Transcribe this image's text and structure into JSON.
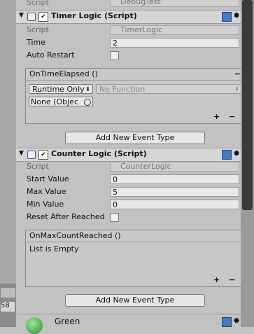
{
  "top": {
    "script_label": "Script",
    "script_value": "DebugTest"
  },
  "timer": {
    "title": "Timer Logic (Script)",
    "script_label": "Script",
    "script_value": "TimerLogic",
    "time_label": "Time",
    "time_value": "2",
    "auto_restart_label": "Auto Restart",
    "event_title": "OnTimeElapsed ()",
    "runtime_option": "Runtime Only",
    "function_option": "No Function",
    "none_object": "None (Objec",
    "add_event_label": "Add New Event Type"
  },
  "counter": {
    "title": "Counter Logic (Script)",
    "script_label": "Script",
    "script_value": "CounterLogic",
    "start_label": "Start Value",
    "start_value": "0",
    "max_label": "Max Value",
    "max_value": "5",
    "min_label": "Min Value",
    "min_value": "0",
    "reset_label": "Reset After Reached",
    "event_title": "OnMaxCountReached ()",
    "empty_text": "List is Empty",
    "add_event_label": "Add New Event Type"
  },
  "bottom": {
    "material_name": "Green"
  },
  "left": {
    "number": "58"
  },
  "symbols": {
    "minus": "−",
    "plus": "+",
    "expand": "▼",
    "check": "✔",
    "gear": "✹",
    "dropdown": "⬍"
  }
}
